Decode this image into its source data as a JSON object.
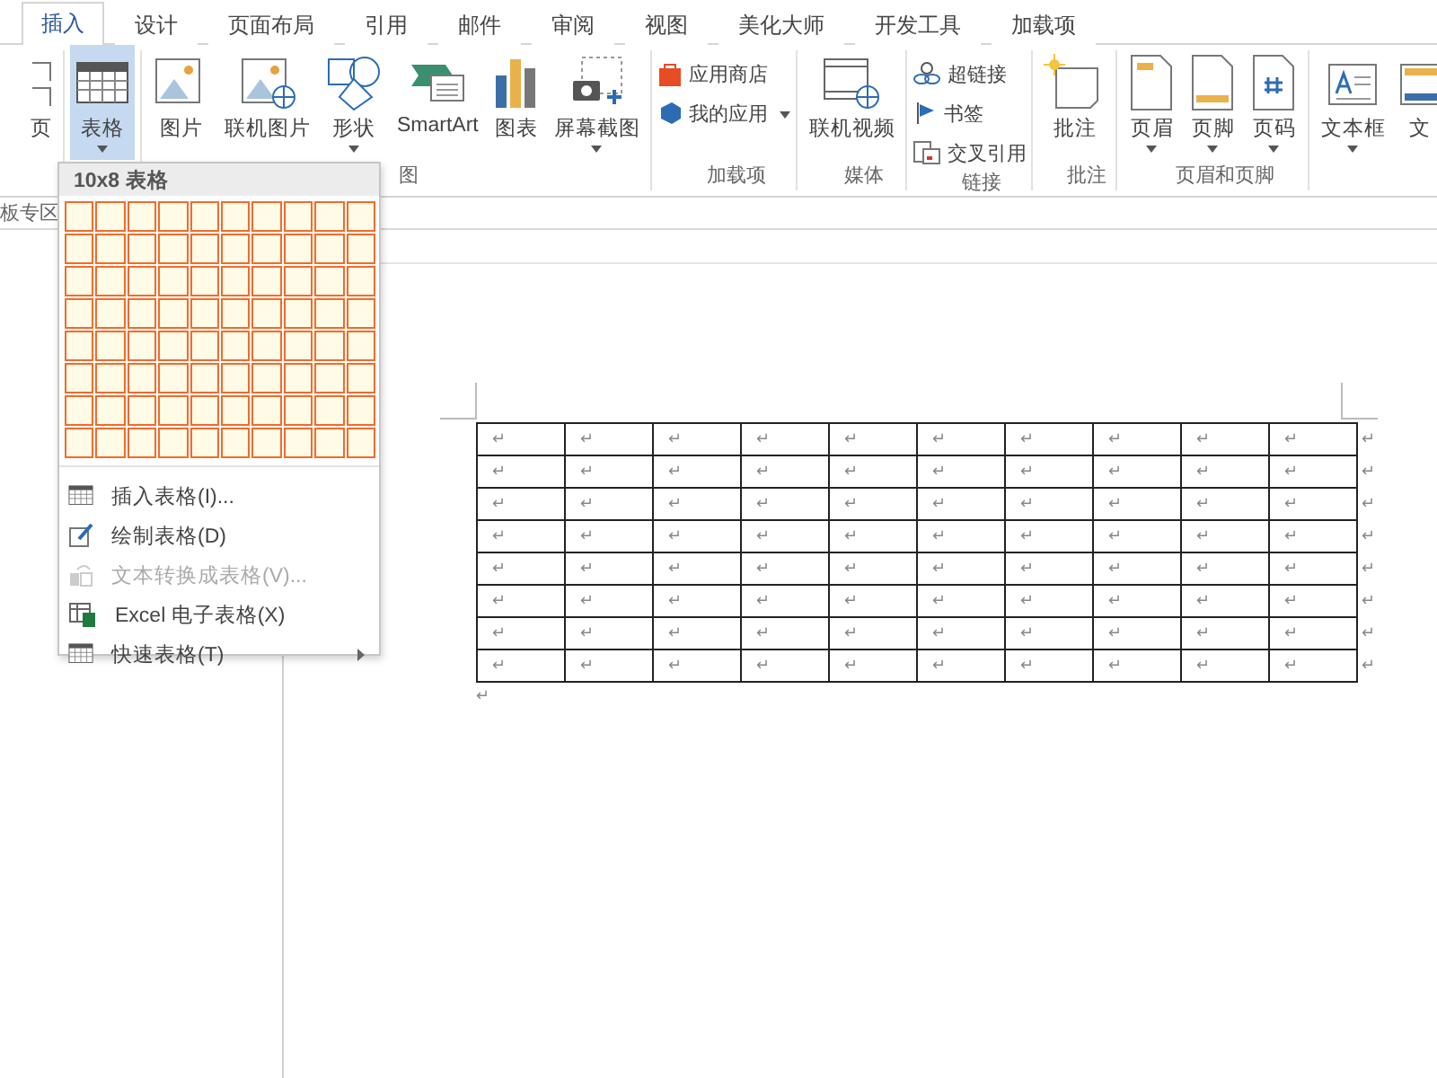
{
  "tabs": [
    {
      "label": "插入",
      "selected": true
    },
    {
      "label": "设计",
      "selected": false
    },
    {
      "label": "页面布局",
      "selected": false
    },
    {
      "label": "引用",
      "selected": false
    },
    {
      "label": "邮件",
      "selected": false
    },
    {
      "label": "审阅",
      "selected": false
    },
    {
      "label": "视图",
      "selected": false
    },
    {
      "label": "美化大师",
      "selected": false
    },
    {
      "label": "开发工具",
      "selected": false
    },
    {
      "label": "加载项",
      "selected": false
    }
  ],
  "ribbon": {
    "groups": [
      {
        "items": [
          {
            "label": "页",
            "kind": "large",
            "caret": false,
            "pressed": false
          }
        ]
      },
      {
        "items": [
          {
            "label": "表格",
            "kind": "large",
            "caret": true,
            "pressed": true
          }
        ]
      },
      {
        "label": "图",
        "items": [
          {
            "label": "图片",
            "kind": "large",
            "caret": false,
            "pressed": false
          },
          {
            "label": "联机图片",
            "kind": "large",
            "caret": false,
            "pressed": false
          },
          {
            "label": "形状",
            "kind": "large",
            "caret": true,
            "pressed": false
          },
          {
            "label": "SmartArt",
            "kind": "large",
            "caret": false,
            "pressed": false
          },
          {
            "label": "图表",
            "kind": "large",
            "caret": false,
            "pressed": false
          },
          {
            "label": "屏幕截图",
            "kind": "large",
            "caret": true,
            "pressed": false
          }
        ]
      },
      {
        "label": "加载项",
        "items": [
          {
            "label": "应用商店",
            "kind": "small",
            "caret": false,
            "pressed": false
          },
          {
            "label": "我的应用",
            "kind": "small",
            "caret": true,
            "pressed": false
          }
        ]
      },
      {
        "label": "媒体",
        "items": [
          {
            "label": "联机视频",
            "kind": "large",
            "caret": false,
            "pressed": false
          }
        ]
      },
      {
        "label": "链接",
        "items": [
          {
            "label": "超链接",
            "kind": "small",
            "caret": false,
            "pressed": false
          },
          {
            "label": "书签",
            "kind": "small",
            "caret": false,
            "pressed": false
          },
          {
            "label": "交叉引用",
            "kind": "small",
            "caret": false,
            "pressed": false
          }
        ]
      },
      {
        "label": "批注",
        "items": [
          {
            "label": "批注",
            "kind": "large",
            "caret": false,
            "pressed": false
          }
        ]
      },
      {
        "label": "页眉和页脚",
        "items": [
          {
            "label": "页眉",
            "kind": "large",
            "caret": true,
            "pressed": false
          },
          {
            "label": "页脚",
            "kind": "large",
            "caret": true,
            "pressed": false
          },
          {
            "label": "页码",
            "kind": "large",
            "caret": true,
            "pressed": false
          }
        ]
      },
      {
        "items": [
          {
            "label": "文本框",
            "kind": "large",
            "caret": true,
            "pressed": false
          },
          {
            "label": "文",
            "kind": "large",
            "caret": false,
            "pressed": false
          }
        ]
      }
    ]
  },
  "nav_pane": {
    "title": "板专区"
  },
  "table_menu": {
    "header": "10x8 表格",
    "grid": [
      {
        "cells": [
          {
            "selected": true
          },
          {
            "selected": true
          },
          {
            "selected": true
          },
          {
            "selected": true
          },
          {
            "selected": true
          },
          {
            "selected": true
          },
          {
            "selected": true
          },
          {
            "selected": true
          },
          {
            "selected": true
          },
          {
            "selected": true
          }
        ]
      },
      {
        "cells": [
          {
            "selected": true
          },
          {
            "selected": true
          },
          {
            "selected": true
          },
          {
            "selected": true
          },
          {
            "selected": true
          },
          {
            "selected": true
          },
          {
            "selected": true
          },
          {
            "selected": true
          },
          {
            "selected": true
          },
          {
            "selected": true
          }
        ]
      },
      {
        "cells": [
          {
            "selected": true
          },
          {
            "selected": true
          },
          {
            "selected": true
          },
          {
            "selected": true
          },
          {
            "selected": true
          },
          {
            "selected": true
          },
          {
            "selected": true
          },
          {
            "selected": true
          },
          {
            "selected": true
          },
          {
            "selected": true
          }
        ]
      },
      {
        "cells": [
          {
            "selected": true
          },
          {
            "selected": true
          },
          {
            "selected": true
          },
          {
            "selected": true
          },
          {
            "selected": true
          },
          {
            "selected": true
          },
          {
            "selected": true
          },
          {
            "selected": true
          },
          {
            "selected": true
          },
          {
            "selected": true
          }
        ]
      },
      {
        "cells": [
          {
            "selected": true
          },
          {
            "selected": true
          },
          {
            "selected": true
          },
          {
            "selected": true
          },
          {
            "selected": true
          },
          {
            "selected": true
          },
          {
            "selected": true
          },
          {
            "selected": true
          },
          {
            "selected": true
          },
          {
            "selected": true
          }
        ]
      },
      {
        "cells": [
          {
            "selected": true
          },
          {
            "selected": true
          },
          {
            "selected": true
          },
          {
            "selected": true
          },
          {
            "selected": true
          },
          {
            "selected": true
          },
          {
            "selected": true
          },
          {
            "selected": true
          },
          {
            "selected": true
          },
          {
            "selected": true
          }
        ]
      },
      {
        "cells": [
          {
            "selected": true
          },
          {
            "selected": true
          },
          {
            "selected": true
          },
          {
            "selected": true
          },
          {
            "selected": true
          },
          {
            "selected": true
          },
          {
            "selected": true
          },
          {
            "selected": true
          },
          {
            "selected": true
          },
          {
            "selected": true
          }
        ]
      },
      {
        "cells": [
          {
            "selected": true
          },
          {
            "selected": true
          },
          {
            "selected": true
          },
          {
            "selected": true
          },
          {
            "selected": true
          },
          {
            "selected": true
          },
          {
            "selected": true
          },
          {
            "selected": true
          },
          {
            "selected": true
          },
          {
            "selected": true
          }
        ]
      }
    ],
    "items": [
      {
        "label": "插入表格(I)...",
        "disabled": false,
        "submenu": false
      },
      {
        "label": "绘制表格(D)",
        "disabled": false,
        "submenu": false
      },
      {
        "label": "文本转换成表格(V)...",
        "disabled": true,
        "submenu": false
      },
      {
        "label": "Excel 电子表格(X)",
        "disabled": false,
        "submenu": false
      },
      {
        "label": "快速表格(T)",
        "disabled": false,
        "submenu": true
      }
    ]
  },
  "document": {
    "rows": [
      {
        "cells": [
          "↵",
          "↵",
          "↵",
          "↵",
          "↵",
          "↵",
          "↵",
          "↵",
          "↵",
          "↵"
        ],
        "end": "↵"
      },
      {
        "cells": [
          "↵",
          "↵",
          "↵",
          "↵",
          "↵",
          "↵",
          "↵",
          "↵",
          "↵",
          "↵"
        ],
        "end": "↵"
      },
      {
        "cells": [
          "↵",
          "↵",
          "↵",
          "↵",
          "↵",
          "↵",
          "↵",
          "↵",
          "↵",
          "↵"
        ],
        "end": "↵"
      },
      {
        "cells": [
          "↵",
          "↵",
          "↵",
          "↵",
          "↵",
          "↵",
          "↵",
          "↵",
          "↵",
          "↵"
        ],
        "end": "↵"
      },
      {
        "cells": [
          "↵",
          "↵",
          "↵",
          "↵",
          "↵",
          "↵",
          "↵",
          "↵",
          "↵",
          "↵"
        ],
        "end": "↵"
      },
      {
        "cells": [
          "↵",
          "↵",
          "↵",
          "↵",
          "↵",
          "↵",
          "↵",
          "↵",
          "↵",
          "↵"
        ],
        "end": "↵"
      },
      {
        "cells": [
          "↵",
          "↵",
          "↵",
          "↵",
          "↵",
          "↵",
          "↵",
          "↵",
          "↵",
          "↵"
        ],
        "end": "↵"
      },
      {
        "cells": [
          "↵",
          "↵",
          "↵",
          "↵",
          "↵",
          "↵",
          "↵",
          "↵",
          "↵",
          "↵"
        ],
        "end": "↵"
      }
    ],
    "after": "↵"
  }
}
